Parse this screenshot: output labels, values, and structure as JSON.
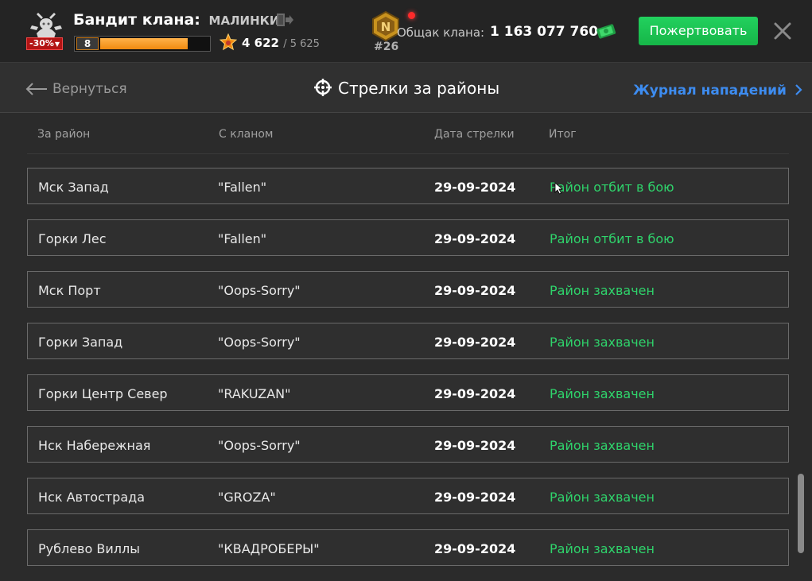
{
  "header": {
    "discount": "-30%",
    "clan_title": "Бандит клана:",
    "clan_name": "МАЛИНКИ",
    "level": "8",
    "level_progress": 0.82,
    "reputation": "4 622",
    "reputation_max": "/ 5 625",
    "clan_rank": "#26",
    "bank_label": "Общак клана:",
    "bank_value": "1 163 077 760",
    "donate_label": "Пожертвовать"
  },
  "nav": {
    "back_label": "Вернуться",
    "title": "Стрелки за районы",
    "journal_label": "Журнал нападений"
  },
  "table": {
    "headers": [
      "За район",
      "С кланом",
      "Дата стрелки",
      "Итог"
    ],
    "rows": [
      {
        "district": "Мск Запад",
        "clan": "\"Fallen\"",
        "date": "29-09-2024",
        "result": "Район отбит в бою"
      },
      {
        "district": "Горки Лес",
        "clan": "\"Fallen\"",
        "date": "29-09-2024",
        "result": "Район отбит в бою"
      },
      {
        "district": "Мск Порт",
        "clan": "\"Oops-Sorry\"",
        "date": "29-09-2024",
        "result": "Район захвачен"
      },
      {
        "district": "Горки Запад",
        "clan": "\"Oops-Sorry\"",
        "date": "29-09-2024",
        "result": "Район захвачен"
      },
      {
        "district": "Горки Центр Север",
        "clan": "\"RAKUZAN\"",
        "date": "29-09-2024",
        "result": "Район захвачен"
      },
      {
        "district": "Нск Набережная",
        "clan": "\"Oops-Sorry\"",
        "date": "29-09-2024",
        "result": "Район захвачен"
      },
      {
        "district": "Нск Автострада",
        "clan": "\"GROZA\"",
        "date": "29-09-2024",
        "result": "Район захвачен"
      },
      {
        "district": "Рублево Виллы",
        "clan": "\"КВАДРОБЕРЫ\"",
        "date": "29-09-2024",
        "result": "Район захвачен"
      }
    ]
  },
  "colors": {
    "accent_green": "#2fd36b",
    "link_blue": "#3d8cf0",
    "donate_green": "#1ec455"
  }
}
